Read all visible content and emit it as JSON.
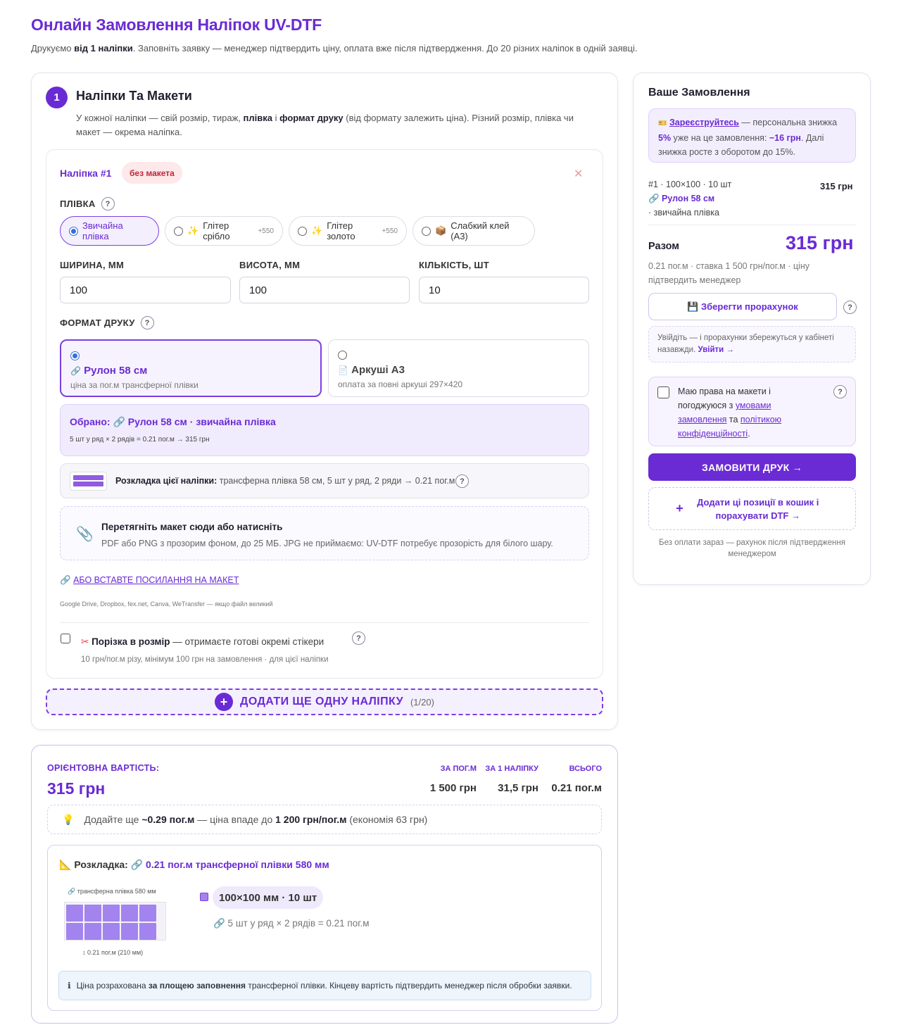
{
  "header": {
    "title": "Онлайн Замовлення Наліпок UV-DTF",
    "subtitle_pre": "Друкуємо ",
    "subtitle_bold": "від 1 наліпки",
    "subtitle_post": ". Заповніть заявку — менеджер підтвердить ціну, оплата вже після підтвердження. До 20 різних наліпок в одній заявці."
  },
  "section": {
    "number": "1",
    "title": "Наліпки Та Макети",
    "desc_1": "У кожної наліпки — свій розмір, тираж, ",
    "desc_b1": "плівка",
    "desc_2": " і ",
    "desc_b2": "формат друку",
    "desc_3": " (від формату залежить ціна). Різний розмір, плівка чи макет — окрема наліпка."
  },
  "sticker": {
    "name": "Наліпка #1",
    "badge": "без макета",
    "close": "✕",
    "film_label": "ПЛІВКА",
    "films": [
      {
        "label": "Звичайна плівка",
        "extra": "",
        "icon": ""
      },
      {
        "label": "Глітер срібло",
        "extra": "+550",
        "icon": "✨"
      },
      {
        "label": "Глітер золото",
        "extra": "+550",
        "icon": "✨"
      },
      {
        "label": "Слабкий клей (А3)",
        "extra": "",
        "icon": "📦"
      }
    ],
    "width_label": "ШИРИНА, ММ",
    "height_label": "ВИСОТА, ММ",
    "qty_label": "КІЛЬКІСТЬ, ШТ",
    "width": "100",
    "height": "100",
    "qty": "10",
    "format_label": "ФОРМАТ ДРУКУ",
    "formats": [
      {
        "title": "Рулон 58 см",
        "sub": "ціна за пог.м трансферної плівки",
        "icon": "🔗"
      },
      {
        "title": "Аркуші А3",
        "sub": "оплата за повні аркуші 297×420",
        "icon": "📄"
      }
    ],
    "chosen_label": "Обрано:",
    "chosen_value": "🔗 Рулон 58 см · звичайна плівка",
    "chosen_calc": "5 шт у ряд × 2 рядів = 0.21 пог.м → 315 грн",
    "layout_bold": "Розкладка цієї наліпки:",
    "layout_text": " трансферна плівка 58 см, 5 шт у ряд, 2 ряди → 0.21 пог.м",
    "drop_title": "Перетягніть макет сюди або натисніть",
    "drop_sub": "PDF або PNG з прозорим фоном, до 25 МБ. JPG не приймаємо: UV-DTF потребує прозорість для білого шару.",
    "link_text": "АБО ВСТАВТЕ ПОСИЛАННЯ НА МАКЕТ",
    "link_hint": "Google Drive, Dropbox, fex.net, Canva, WeTransfer — якщо файл великий",
    "cut_bold": "Порізка в розмір",
    "cut_text": " — отримаєте готові окремі стікери",
    "cut_sub": "10 грн/пог.м різу, мінімум 100 грн на замовлення · для цієї наліпки"
  },
  "add_more": {
    "label": "ДОДАТИ ЩЕ ОДНУ НАЛІПКУ",
    "count": "(1/20)"
  },
  "sidebar": {
    "title": "Ваше Замовлення",
    "promo_link": "Зареєструйтесь",
    "promo_1": " — персональна знижка ",
    "promo_pct": "5%",
    "promo_2": " уже на це замовлення: ",
    "promo_amount": "−16 грн",
    "promo_3": ". Далі знижка росте з оборотом до 15%.",
    "item_line1": "#1 · 100×100 · 10 шт",
    "item_line2": "🔗 Рулон 58 см",
    "item_line3": "· звичайна плівка",
    "item_price": "315 грн",
    "total_label": "Разом",
    "total_value": "315 грн",
    "total_note": "0.21 пог.м · ставка 1 500 грн/пог.м · ціну підтвердить менеджер",
    "save_label": "💾 Зберегти прорахунок",
    "login_text": "Увійдіть — і прорахунки збережуться у кабінеті назавжди. ",
    "login_link": "Увійти →",
    "agree_1": "Маю права на макети і погоджуюся з ",
    "agree_link1": "умовами замовлення",
    "agree_2": " та ",
    "agree_link2": "політикою конфіденційності",
    "agree_3": ".",
    "order_label": "ЗАМОВИТИ ДРУК →",
    "cart_label": "Додати ці позиції в кошик і порахувати DTF →",
    "footnote": "Без оплати зараз — рахунок після підтвердження менеджером"
  },
  "estimate": {
    "label": "ОРІЄНТОВНА ВАРТІСТЬ:",
    "value": "315 грн",
    "cols": [
      {
        "head": "ЗА ПОГ.М",
        "val": "1 500 грн"
      },
      {
        "head": "ЗА 1 НАЛІПКУ",
        "val": "31,5 грн"
      },
      {
        "head": "ВСЬОГО",
        "val": "0.21 пог.м"
      }
    ],
    "tip_1": "Додайте ще ",
    "tip_b1": "~0.29 пог.м",
    "tip_2": " — ціна впаде до ",
    "tip_b2": "1 200 грн/пог.м",
    "tip_3": " (економія 63 грн)",
    "layout_title": "Розкладка:",
    "layout_value": "🔗 0.21 пог.м трансферної плівки 580 мм",
    "film_caption": "🔗 трансферна плівка 580 мм",
    "length_caption": "↕ 0.21 пог.м (210 мм)",
    "item_pill": "100×100 мм · 10 шт",
    "item_calc": "🔗 5 шт у ряд × 2 рядів = 0.21 пог.м",
    "info_1": "Ціна розрахована ",
    "info_b": "за площею заповнення",
    "info_2": " трансферної плівки. Кінцеву вартість підтвердить менеджер після обробки заявки."
  },
  "colors": {
    "accent": "#6a2bd4",
    "cell": "#a383ee",
    "badge_bg": "#fde8ea",
    "badge_text": "#c0263a"
  }
}
